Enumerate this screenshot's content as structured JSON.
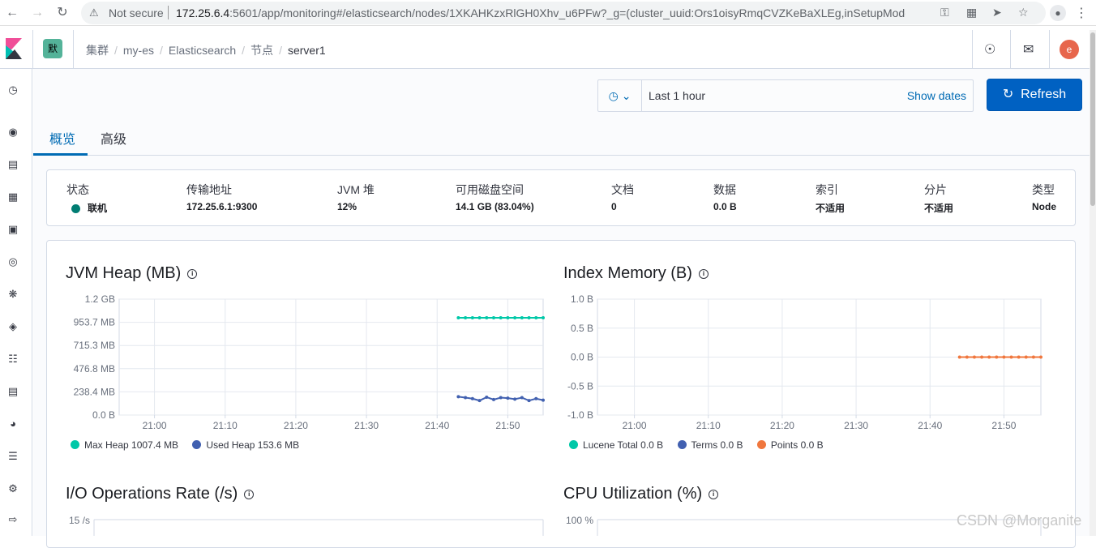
{
  "browser": {
    "not_secure": "Not secure",
    "url_host": "172.25.6.4",
    "url_rest": ":5601/app/monitoring#/elasticsearch/nodes/1XKAHKzxRlGH0Xhv_u6PFw?_g=(cluster_uuid:Ors1oisyRmqCVZKeBaXLEg,inSetupMode:!t)"
  },
  "header": {
    "space_letter": "默",
    "breadcrumbs": [
      "集群",
      "my-es",
      "Elasticsearch",
      "节点",
      "server1"
    ],
    "user_initial": "e"
  },
  "toolbar": {
    "time_range": "Last 1 hour",
    "show_dates": "Show dates",
    "refresh_label": "Refresh"
  },
  "tabs": [
    "概览",
    "高级"
  ],
  "summary": [
    {
      "label": "状态",
      "value": "联机"
    },
    {
      "label": "传输地址",
      "value": "172.25.6.1:9300"
    },
    {
      "label": "JVM 堆",
      "value": "12%"
    },
    {
      "label": "可用磁盘空间",
      "value": "14.1 GB (83.04%)"
    },
    {
      "label": "文档",
      "value": "0"
    },
    {
      "label": "数据",
      "value": "0.0 B"
    },
    {
      "label": "索引",
      "value": "不适用"
    },
    {
      "label": "分片",
      "value": "不适用"
    },
    {
      "label": "类型",
      "value": "Node"
    }
  ],
  "colors": {
    "online": "#017d73",
    "max_heap": "#00c8a8",
    "used_heap": "#4160b0",
    "lucene": "#00c8a8",
    "terms": "#4160b0",
    "points": "#f0773e",
    "primary": "#0061c2"
  },
  "chart_data": [
    {
      "type": "line",
      "title": "JVM Heap (MB)",
      "x_ticks": [
        "21:00",
        "21:10",
        "21:20",
        "21:30",
        "21:40",
        "21:50"
      ],
      "y_ticks": [
        "0.0 B",
        "238.4 MB",
        "476.8 MB",
        "715.3 MB",
        "953.7 MB",
        "1.2 GB"
      ],
      "ylim": [
        0,
        1200
      ],
      "series": [
        {
          "name": "Max Heap 1007.4 MB",
          "color": "#00c8a8",
          "x": [
            "21:43",
            "21:44",
            "21:45",
            "21:46",
            "21:47",
            "21:48",
            "21:49",
            "21:50",
            "21:51",
            "21:52",
            "21:53",
            "21:54",
            "21:55"
          ],
          "values": [
            1007,
            1007,
            1007,
            1007,
            1007,
            1007,
            1007,
            1007,
            1007,
            1007,
            1007,
            1007,
            1007
          ]
        },
        {
          "name": "Used Heap 153.6 MB",
          "color": "#4160b0",
          "x": [
            "21:43",
            "21:44",
            "21:45",
            "21:46",
            "21:47",
            "21:48",
            "21:49",
            "21:50",
            "21:51",
            "21:52",
            "21:53",
            "21:54",
            "21:55"
          ],
          "values": [
            190,
            180,
            170,
            150,
            185,
            160,
            180,
            175,
            165,
            180,
            150,
            170,
            154
          ]
        }
      ]
    },
    {
      "type": "line",
      "title": "Index Memory (B)",
      "x_ticks": [
        "21:00",
        "21:10",
        "21:20",
        "21:30",
        "21:40",
        "21:50"
      ],
      "y_ticks": [
        "-1.0 B",
        "-0.5 B",
        "0.0 B",
        "0.5 B",
        "1.0 B"
      ],
      "ylim": [
        -1,
        1
      ],
      "series": [
        {
          "name": "Lucene Total 0.0 B",
          "color": "#00c8a8",
          "x": [],
          "values": []
        },
        {
          "name": "Terms 0.0 B",
          "color": "#4160b0",
          "x": [],
          "values": []
        },
        {
          "name": "Points 0.0 B",
          "color": "#f0773e",
          "x": [
            "21:44",
            "21:45",
            "21:46",
            "21:47",
            "21:48",
            "21:49",
            "21:50",
            "21:51",
            "21:52",
            "21:53",
            "21:54",
            "21:55"
          ],
          "values": [
            0,
            0,
            0,
            0,
            0,
            0,
            0,
            0,
            0,
            0,
            0,
            0
          ]
        }
      ]
    },
    {
      "type": "line",
      "title": "I/O Operations Rate (/s)",
      "y_ticks": [
        "15 /s"
      ]
    },
    {
      "type": "line",
      "title": "CPU Utilization (%)",
      "y_ticks": [
        "100 %"
      ]
    }
  ],
  "watermark": "CSDN @Morganite"
}
